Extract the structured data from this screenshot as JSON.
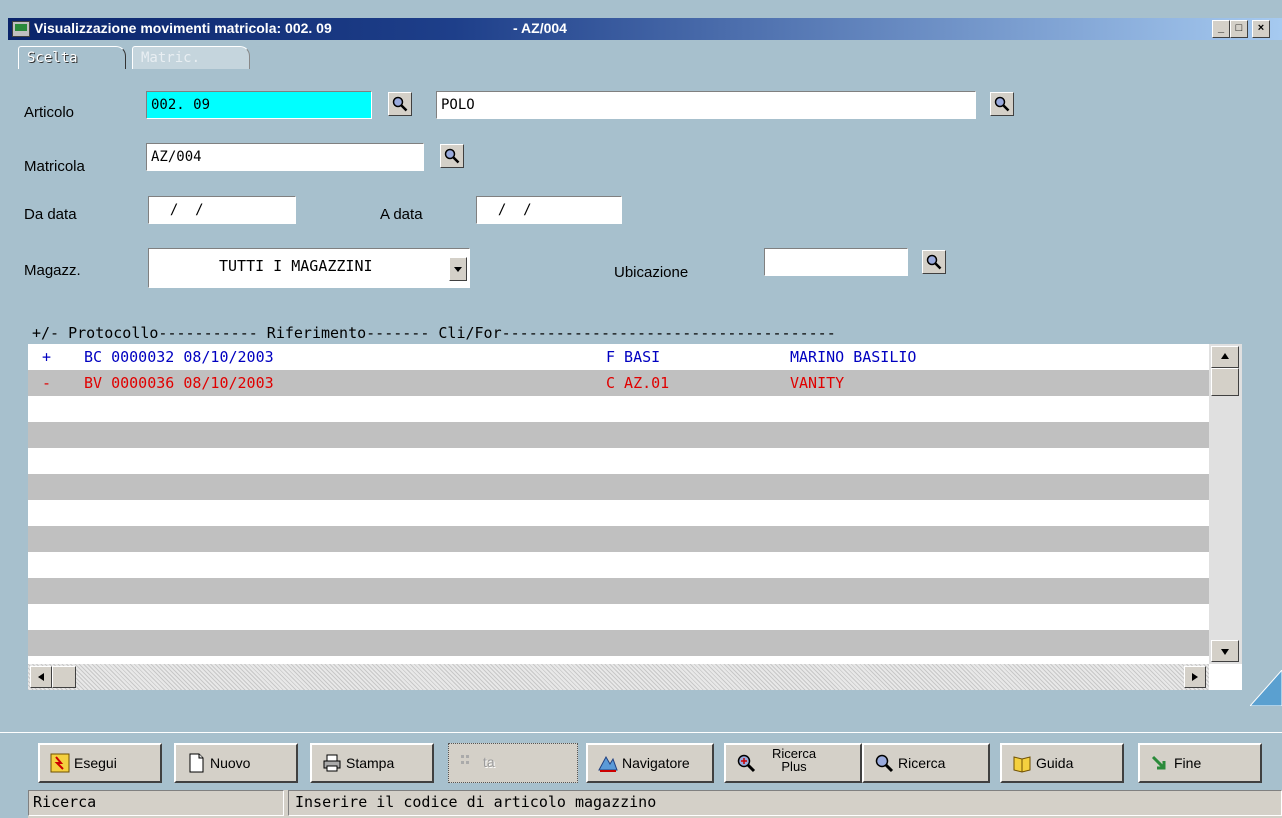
{
  "window": {
    "title": "Visualizzazione movimenti matricola: 002. 09",
    "title_suffix": "- AZ/004",
    "minimize_label": "_",
    "maximize_label": "□",
    "close_label": "×"
  },
  "tabs": [
    {
      "label": "Scelta",
      "active": true
    },
    {
      "label": "Matric.",
      "active": false
    }
  ],
  "form": {
    "articolo_label": "Articolo",
    "articolo_code": "002. 09",
    "articolo_desc": "POLO",
    "matricola_label": "Matricola",
    "matricola_value": "AZ/004",
    "da_data_label": "Da data",
    "da_data_value": "  /  /",
    "a_data_label": "A data",
    "a_data_value": "  /  /",
    "magazz_label": "Magazz.",
    "magazz_value": "TUTTI I MAGAZZINI",
    "ubicazione_label": "Ubicazione",
    "ubicazione_value": ""
  },
  "list": {
    "header": "+/- Protocollo----------- Riferimento------- Cli/For-------------------------------------",
    "rows": [
      {
        "sign": "+",
        "protocollo": "BC 0000032 08/10/2003",
        "tipo": "F BASI",
        "nome": "MARINO BASILIO",
        "color": "#0000c0"
      },
      {
        "sign": "-",
        "protocollo": "BV 0000036 08/10/2003",
        "tipo": "C AZ.01",
        "nome": "VANITY",
        "color": "#e00000"
      }
    ]
  },
  "toolbar": {
    "esegui": "Esegui",
    "nuovo": "Nuovo",
    "stampa": "Stampa",
    "disabled": "ta",
    "navigatore": "Navigatore",
    "ricerca_plus_1": "Ricerca",
    "ricerca_plus_2": "Plus",
    "ricerca": "Ricerca",
    "guida": "Guida",
    "fine": "Fine"
  },
  "status": {
    "left": "Ricerca",
    "right": "Inserire il codice di articolo magazzino"
  }
}
